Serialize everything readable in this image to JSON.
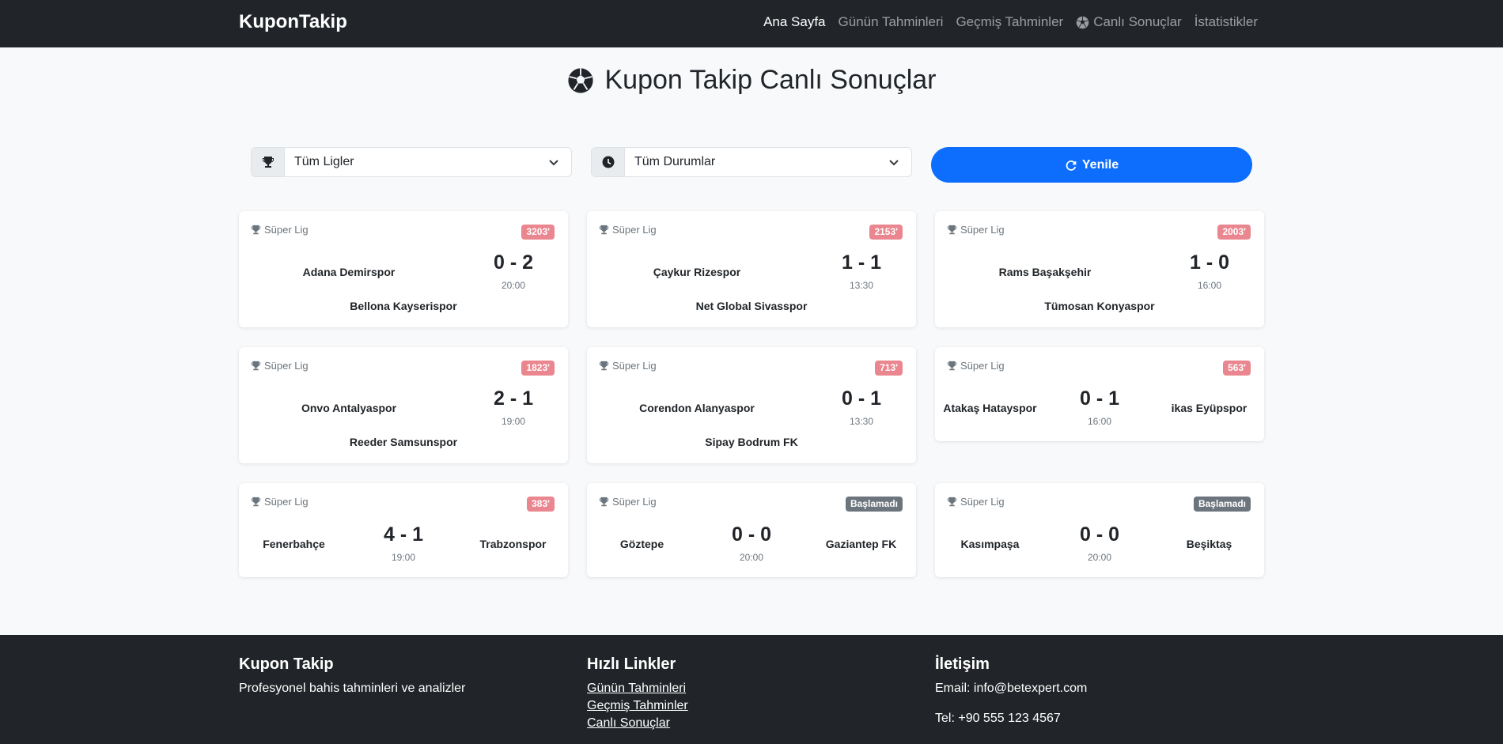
{
  "navbar": {
    "brand": "KuponTakip",
    "links": [
      {
        "label": "Ana Sayfa"
      },
      {
        "label": "Günün Tahminleri"
      },
      {
        "label": "Geçmiş Tahminler"
      },
      {
        "label": "Canlı Sonuçlar"
      },
      {
        "label": "İstatistikler"
      }
    ]
  },
  "page": {
    "title": "Kupon Takip Canlı Sonuçlar"
  },
  "filters": {
    "league": "Tüm Ligler",
    "status": "Tüm Durumlar",
    "refresh_label": "Yenile"
  },
  "matches": [
    {
      "league": "Süper Lig",
      "badge": "3203'",
      "home": "Adana Demirspor",
      "away": "Bellona Kayserispor",
      "score": "0 - 2",
      "time": "20:00"
    },
    {
      "league": "Süper Lig",
      "badge": "2153'",
      "home": "Çaykur Rizespor",
      "away": "Net Global Sivasspor",
      "score": "1 - 1",
      "time": "13:30"
    },
    {
      "league": "Süper Lig",
      "badge": "2003'",
      "home": "Rams Başakşehir",
      "away": "Tümosan Konyaspor",
      "score": "1 - 0",
      "time": "16:00"
    },
    {
      "league": "Süper Lig",
      "badge": "1823'",
      "home": "Onvo Antalyaspor",
      "away": "Reeder Samsunspor",
      "score": "2 - 1",
      "time": "19:00"
    },
    {
      "league": "Süper Lig",
      "badge": "713'",
      "home": "Corendon Alanyaspor",
      "away": "Sipay Bodrum FK",
      "score": "0 - 1",
      "time": "13:30"
    },
    {
      "league": "Süper Lig",
      "badge": "563'",
      "home": "Atakaş Hatayspor",
      "away": "ikas Eyüpspor",
      "score": "0 - 1",
      "time": "16:00"
    },
    {
      "league": "Süper Lig",
      "badge": "383'",
      "home": "Fenerbahçe",
      "away": "Trabzonspor",
      "score": "4 - 1",
      "time": "19:00"
    },
    {
      "league": "Süper Lig",
      "badge": "Başlamadı",
      "home": "Göztepe",
      "away": "Gaziantep FK",
      "score": "0 - 0",
      "time": "20:00"
    },
    {
      "league": "Süper Lig",
      "badge": "Başlamadı",
      "home": "Kasımpaşa",
      "away": "Beşiktaş",
      "score": "0 - 0",
      "time": "20:00"
    }
  ],
  "footer": {
    "about": {
      "title": "Kupon Takip",
      "text": "Profesyonel bahis tahminleri ve analizler"
    },
    "links": {
      "title": "Hızlı Linkler",
      "items": [
        "Günün Tahminleri",
        "Geçmiş Tahminler",
        "Canlı Sonuçlar"
      ]
    },
    "contact": {
      "title": "İletişim",
      "email": "Email: info@betexpert.com",
      "phone": "Tel: +90 555 123 4567"
    }
  },
  "colors": {
    "navbar": "#212529",
    "primary": "#0d6efd",
    "live_badge": "#ea868f",
    "not_started_badge": "#6c757d"
  }
}
